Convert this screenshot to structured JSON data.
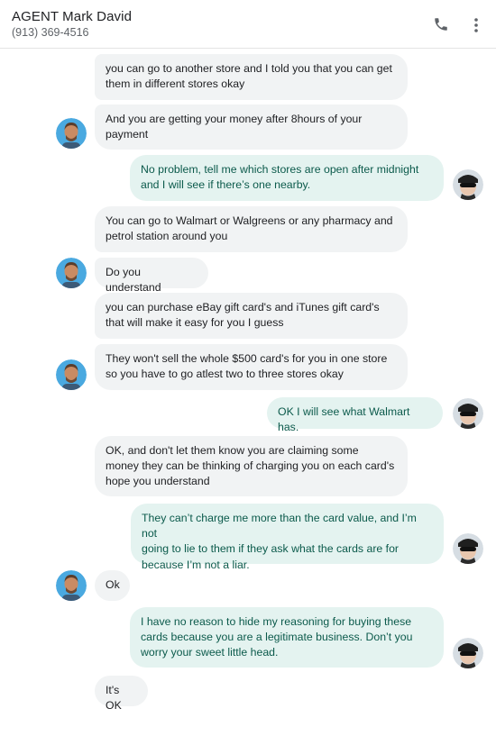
{
  "header": {
    "contact_name": "AGENT Mark David",
    "contact_phone": "(913) 369-4516",
    "call_icon": "phone-icon",
    "more_icon": "more-vert-icon"
  },
  "colors": {
    "incoming_bubble": "#f1f3f4",
    "outgoing_bubble": "#e4f3f0",
    "outgoing_text": "#0b5a4b"
  },
  "messages": [
    {
      "direction": "incoming",
      "text": "you can go to another store and I told you that you can get\nthem in  different stores okay"
    },
    {
      "direction": "incoming",
      "text": "And you are getting your money after 8hours of your\npayment"
    },
    {
      "direction": "outgoing",
      "text": "No problem, tell me which stores are open after midnight\nand I will see if there’s one nearby."
    },
    {
      "direction": "incoming",
      "text": "You can go to Walmart or Walgreens or any pharmacy and\npetrol station around you"
    },
    {
      "direction": "incoming",
      "text": "Do you understand"
    },
    {
      "direction": "incoming",
      "text": "you can purchase eBay gift card's and iTunes gift card's\nthat will make it easy for you I guess"
    },
    {
      "direction": "incoming",
      "text": "They won't sell the whole $500 card's for you in one store\nso you have to go atlest two to three stores okay"
    },
    {
      "direction": "outgoing",
      "text": "OK I will see what Walmart has."
    },
    {
      "direction": "incoming",
      "text": "OK, and don't let them  know  you are claiming some\nmoney they can be thinking of charging you on each card's\nhope you understand"
    },
    {
      "direction": "outgoing",
      "text": "They can’t charge me more than the card value, and I’m not\ngoing to lie to them if they ask what the cards are for\nbecause I’m not a liar."
    },
    {
      "direction": "incoming",
      "text": "Ok"
    },
    {
      "direction": "outgoing",
      "text": "I have no reason to hide my reasoning for buying these\ncards because you are a legitimate business. Don’t you\nworry your sweet little head."
    },
    {
      "direction": "incoming",
      "text": "It's OK"
    }
  ]
}
